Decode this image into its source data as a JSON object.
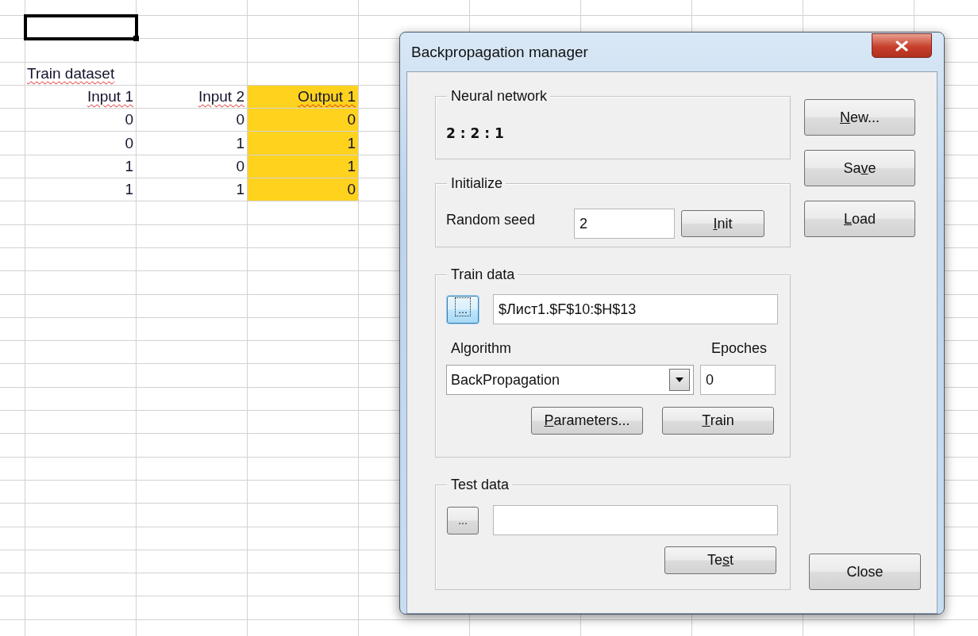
{
  "sheet": {
    "rows": [
      {
        "cells": [
          {
            "selected": true
          },
          {
            "selected": false
          },
          {
            "selected": false
          }
        ]
      },
      {
        "cells": [
          {
            "selected": false
          },
          {
            "selected": false
          },
          {
            "selected": false
          }
        ]
      },
      {
        "cells": [
          {
            "selected": false,
            "text": "Train dataset",
            "kind": "label",
            "misspelled": true
          },
          {
            "selected": false
          },
          {
            "selected": false
          }
        ]
      },
      {
        "cells": [
          {
            "selected": false,
            "text": "Input 1",
            "kind": "value",
            "misspelled": true
          },
          {
            "selected": false,
            "text": "Input 2",
            "kind": "value",
            "misspelled": true
          },
          {
            "selected": false,
            "text": "Output 1",
            "kind": "value",
            "misspelled": true,
            "color": "#ffd21e"
          }
        ]
      },
      {
        "cells": [
          {
            "selected": false,
            "text": "0",
            "kind": "value"
          },
          {
            "selected": false,
            "text": "0",
            "kind": "value"
          },
          {
            "selected": false,
            "text": "0",
            "kind": "value",
            "color": "#ffd21e"
          }
        ]
      },
      {
        "cells": [
          {
            "selected": false,
            "text": "0",
            "kind": "value"
          },
          {
            "selected": false,
            "text": "1",
            "kind": "value"
          },
          {
            "selected": false,
            "text": "1",
            "kind": "value",
            "color": "#ffd21e"
          }
        ]
      },
      {
        "cells": [
          {
            "selected": false,
            "text": "1",
            "kind": "value"
          },
          {
            "selected": false,
            "text": "0",
            "kind": "value"
          },
          {
            "selected": false,
            "text": "1",
            "kind": "value",
            "color": "#ffd21e"
          }
        ]
      },
      {
        "cells": [
          {
            "selected": false,
            "text": "1",
            "kind": "value"
          },
          {
            "selected": false,
            "text": "1",
            "kind": "value"
          },
          {
            "selected": false,
            "text": "0",
            "kind": "value",
            "color": "#ffd21e"
          }
        ]
      }
    ]
  },
  "dialog": {
    "title": "Backpropagation manager",
    "network": {
      "title": "Neural network",
      "structure": "2 : 2 : 1"
    },
    "initialize": {
      "title": "Initialize",
      "seed_label": "Random seed",
      "seed_value": "2",
      "init_button": {
        "key": "I",
        "post": "nit"
      }
    },
    "train": {
      "title": "Train data",
      "pick_button": {
        "label": "...",
        "focused": true
      },
      "range_value": "$Лист1.$F$10:$H$13",
      "algorithm_label": "Algorithm",
      "epochs_label": "Epoches",
      "algorithm_value": "BackPropagation",
      "epochs_value": "0",
      "buttons": [
        {
          "key": "P",
          "post": "arameters..."
        },
        {
          "key": "T",
          "post": "rain"
        }
      ]
    },
    "test": {
      "title": "Test data",
      "pick_button": {
        "label": "...",
        "focused": false
      },
      "test_button": {
        "pre": "Te",
        "key": "s",
        "post": "t"
      }
    },
    "side_buttons": [
      {
        "key": "N",
        "post": "ew..."
      },
      {
        "pre": "Sa",
        "key": "v",
        "post": "e"
      },
      {
        "key": "L",
        "post": "oad"
      }
    ],
    "close_button": {
      "pre": "Close"
    }
  }
}
